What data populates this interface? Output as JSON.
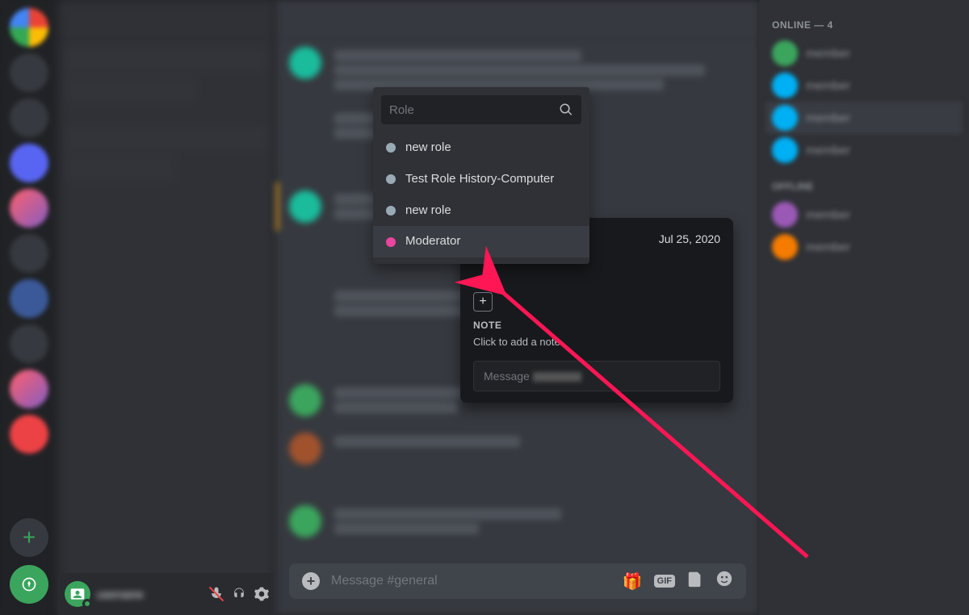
{
  "members_heading": "ONLINE — 4",
  "chat_input_placeholder": "Message #general",
  "popout": {
    "member_since": "Jul 25, 2020",
    "note_heading": "NOTE",
    "note_placeholder": "Click to add a note",
    "message_prefix": "Message"
  },
  "role_search": {
    "placeholder": "Role",
    "items": [
      {
        "label": "new role",
        "color": "gray"
      },
      {
        "label": "Test Role History-Computer",
        "color": "gray"
      },
      {
        "label": "new role",
        "color": "gray"
      },
      {
        "label": "Moderator",
        "color": "pink",
        "highlighted": true
      }
    ]
  },
  "icons": {
    "add_server": "+",
    "plus": "+",
    "gift": "🎁",
    "gif": "GIF",
    "sticker": "📄",
    "emoji": "😊"
  }
}
